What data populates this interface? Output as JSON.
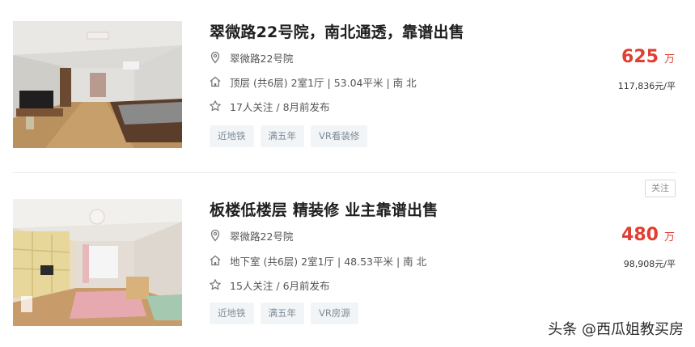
{
  "listings": [
    {
      "title": "翠微路22号院，南北通透，靠谱出售",
      "community": "翠微路22号院",
      "house_info": "顶层 (共6层) 2室1厅 | 53.04平米 | 南 北",
      "follow_info": "17人关注 / 8月前发布",
      "tags": [
        "近地铁",
        "满五年",
        "VR看装修"
      ],
      "price": "625",
      "price_unit": "万",
      "unit_price": "117,836元/平"
    },
    {
      "title": "板楼低楼层 精装修 业主靠谱出售",
      "community": "翠微路22号院",
      "house_info": "地下室 (共6层) 2室1厅 | 48.53平米 | 南 北",
      "follow_info": "15人关注 / 6月前发布",
      "tags": [
        "近地铁",
        "满五年",
        "VR房源"
      ],
      "price": "480",
      "price_unit": "万",
      "unit_price": "98,908元/平",
      "follow_button": "关注"
    }
  ],
  "watermark": "头条 @西瓜姐教买房",
  "colors": {
    "price": "#e03f32",
    "tag_bg": "#f2f5f7",
    "tag_text": "#7f8c97"
  },
  "icons": [
    "location-pin-icon",
    "house-icon",
    "star-icon"
  ]
}
